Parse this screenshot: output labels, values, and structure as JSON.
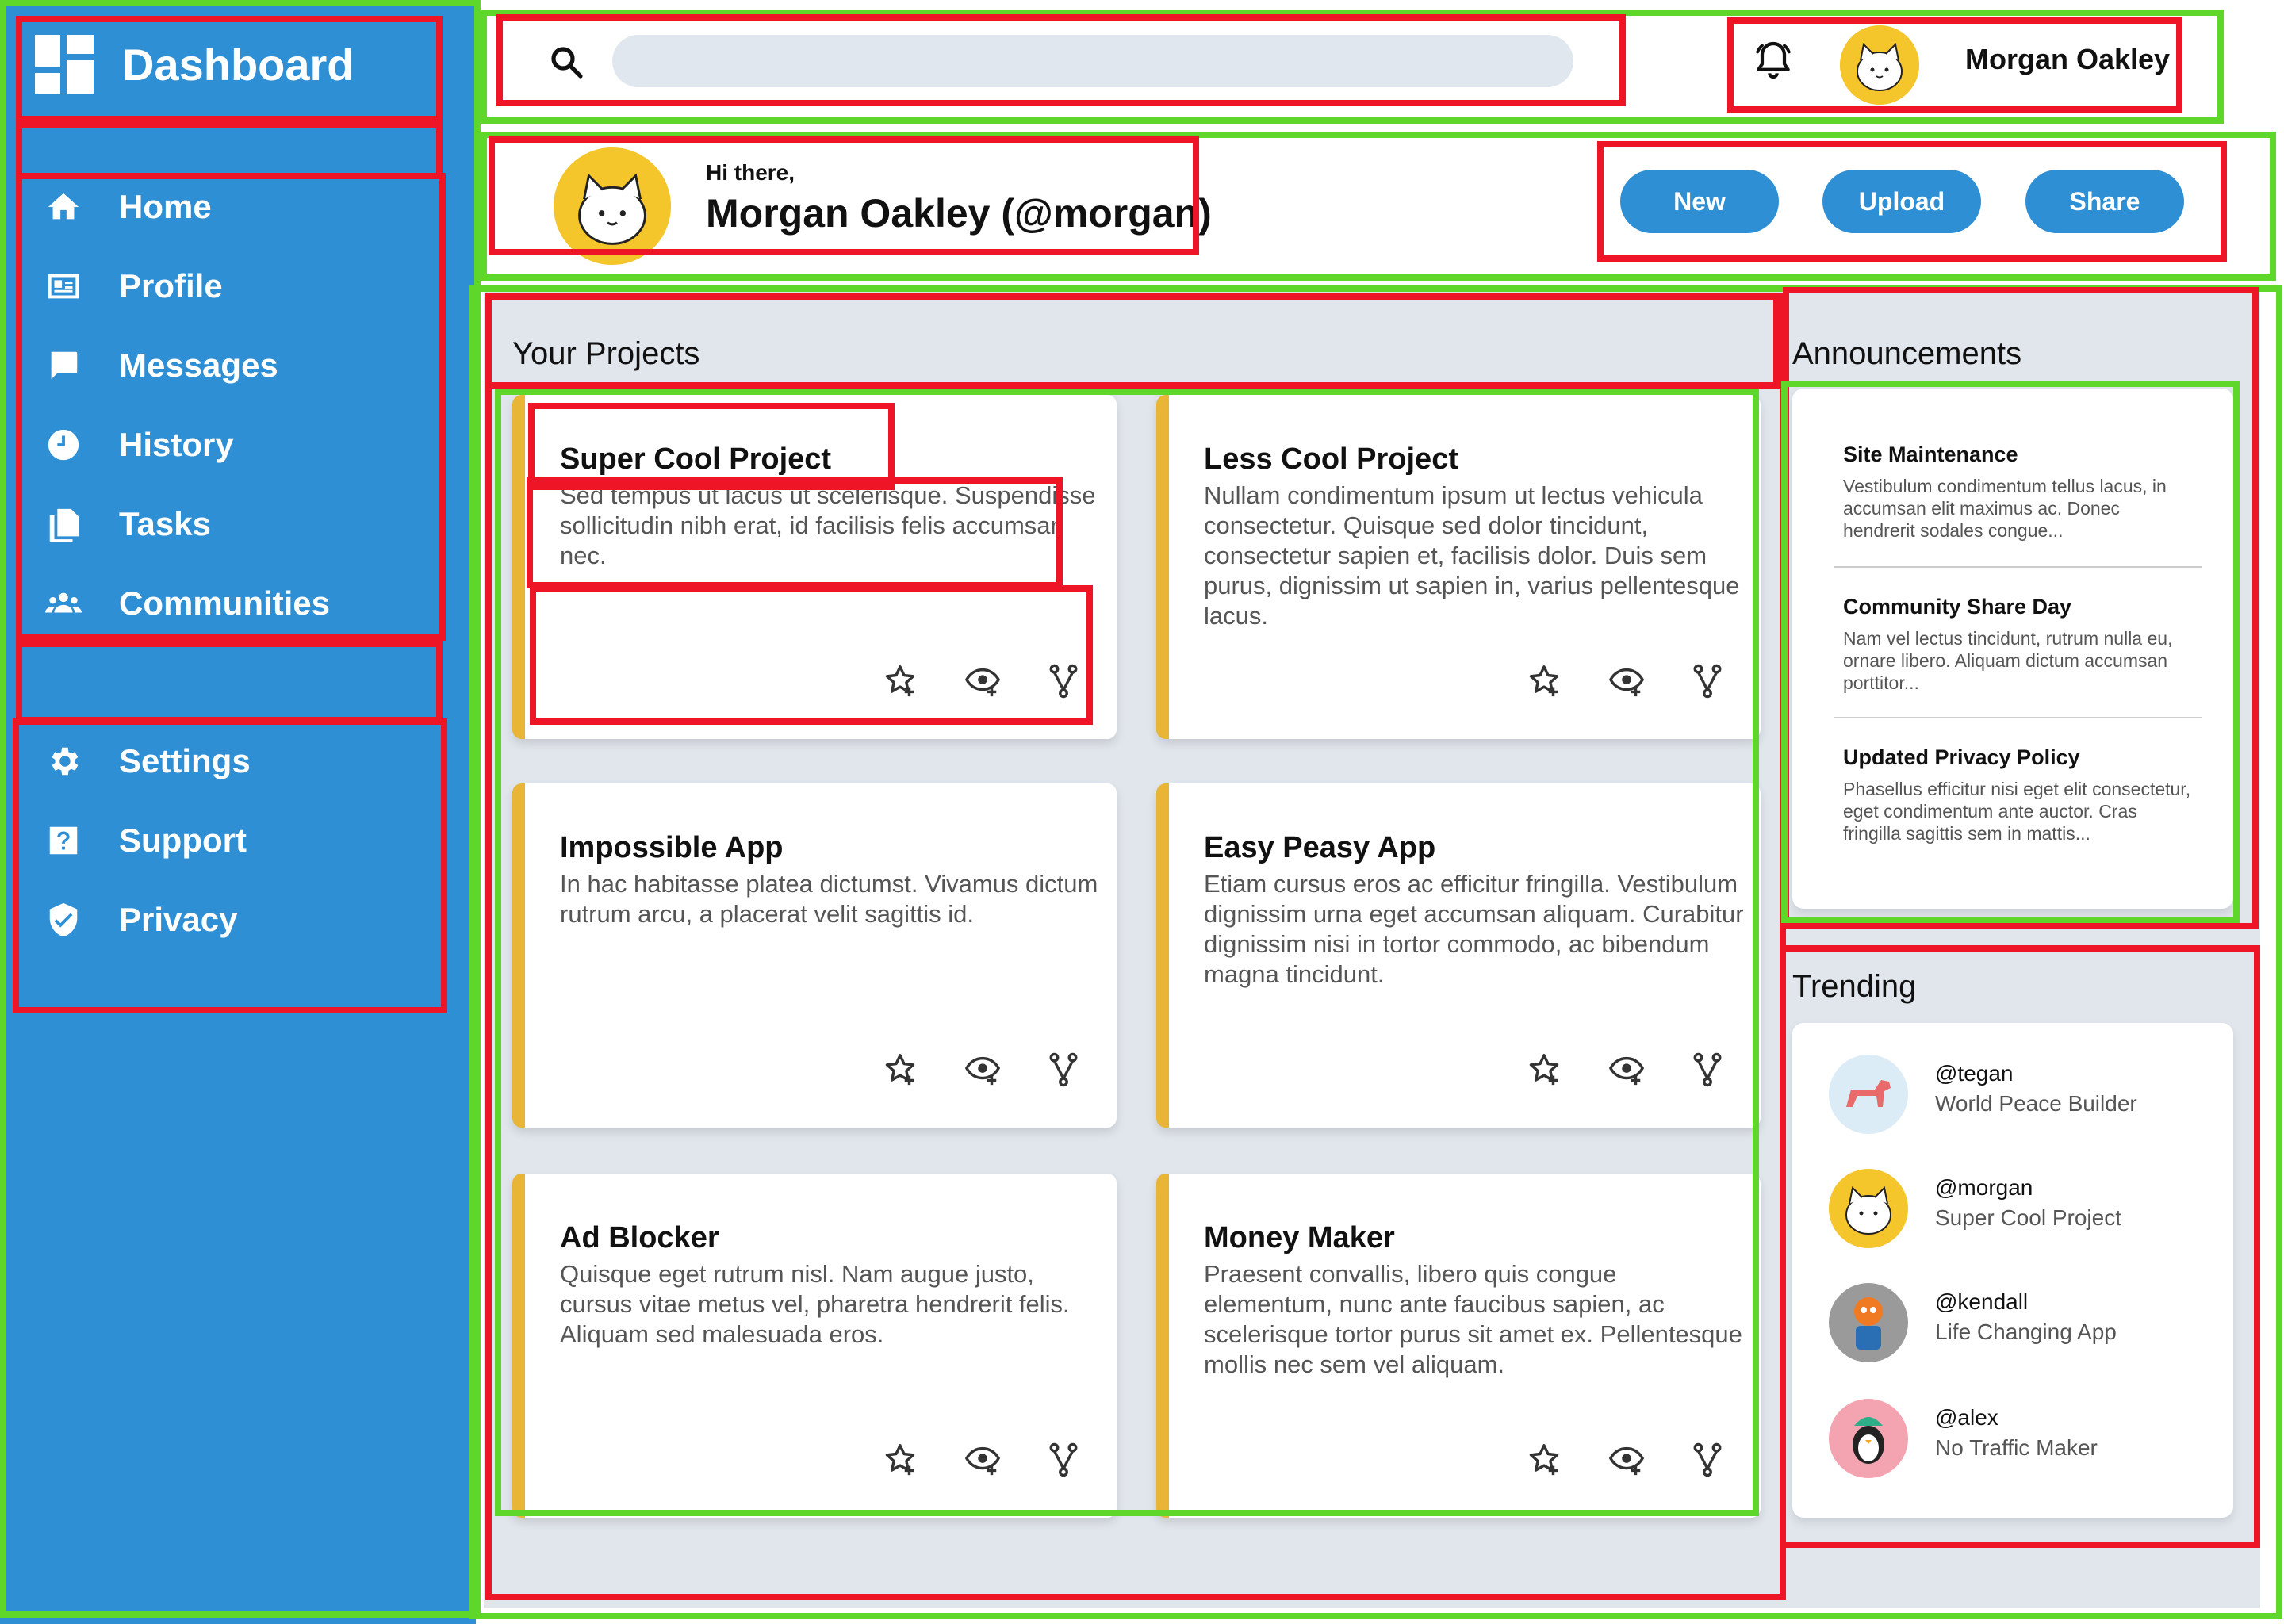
{
  "sidebar": {
    "brand": "Dashboard",
    "nav": [
      {
        "label": "Home",
        "icon": "home-icon"
      },
      {
        "label": "Profile",
        "icon": "profile-icon"
      },
      {
        "label": "Messages",
        "icon": "messages-icon"
      },
      {
        "label": "History",
        "icon": "history-icon"
      },
      {
        "label": "Tasks",
        "icon": "tasks-icon"
      },
      {
        "label": "Communities",
        "icon": "communities-icon"
      }
    ],
    "nav_secondary": [
      {
        "label": "Settings",
        "icon": "gear-icon"
      },
      {
        "label": "Support",
        "icon": "help-icon"
      },
      {
        "label": "Privacy",
        "icon": "shield-icon"
      }
    ]
  },
  "header": {
    "search_placeholder": "",
    "user_name": "Morgan Oakley"
  },
  "greeting": {
    "hi": "Hi there,",
    "name": "Morgan Oakley (@morgan)",
    "buttons": [
      "New",
      "Upload",
      "Share"
    ]
  },
  "projects": {
    "title": "Your Projects",
    "items": [
      {
        "title": "Super Cool Project",
        "desc": "Sed tempus ut lacus ut scelerisque. Suspendisse sollicitudin nibh erat, id facilisis felis accumsan nec."
      },
      {
        "title": "Less Cool Project",
        "desc": "Nullam condimentum ipsum ut lectus vehicula consectetur. Quisque sed dolor tincidunt, consectetur sapien et, facilisis dolor. Duis sem purus, dignissim ut sapien in, varius pellentesque lacus."
      },
      {
        "title": "Impossible App",
        "desc": "In hac habitasse platea dictumst. Vivamus dictum rutrum arcu, a placerat velit sagittis id."
      },
      {
        "title": "Easy Peasy App",
        "desc": "Etiam cursus eros ac efficitur fringilla. Vestibulum dignissim urna eget accumsan aliquam. Curabitur dignissim nisi in tortor commodo, ac bibendum magna tincidunt."
      },
      {
        "title": "Ad Blocker",
        "desc": "Quisque eget rutrum nisl. Nam augue justo, cursus vitae metus vel, pharetra hendrerit felis. Aliquam sed malesuada eros."
      },
      {
        "title": "Money Maker",
        "desc": "Praesent convallis, libero quis congue elementum, nunc ante faucibus sapien, ac scelerisque tortor purus sit amet ex. Pellentesque mollis nec sem vel aliquam."
      }
    ],
    "actions": [
      "star-add-icon",
      "watch-icon",
      "fork-icon"
    ]
  },
  "announcements": {
    "title": "Announcements",
    "items": [
      {
        "title": "Site Maintenance",
        "text": "Vestibulum condimentum tellus lacus, in accumsan elit maximus ac. Donec hendrerit sodales congue..."
      },
      {
        "title": "Community Share Day",
        "text": "Nam vel lectus tincidunt, rutrum nulla eu, ornare libero. Aliquam dictum accumsan porttitor..."
      },
      {
        "title": "Updated Privacy Policy",
        "text": "Phasellus efficitur nisi eget elit consectetur, eget condimentum ante auctor. Cras fringilla sagittis sem in mattis..."
      }
    ]
  },
  "trending": {
    "title": "Trending",
    "items": [
      {
        "handle": "@tegan",
        "desc": "World Peace Builder",
        "avatar_bg": "#dcecf7"
      },
      {
        "handle": "@morgan",
        "desc": "Super Cool Project",
        "avatar_bg": "#f5c52c"
      },
      {
        "handle": "@kendall",
        "desc": "Life Changing App",
        "avatar_bg": "#9a9a9a"
      },
      {
        "handle": "@alex",
        "desc": "No Traffic Maker",
        "avatar_bg": "#f4a3b0"
      }
    ]
  },
  "colors": {
    "sidebar": "#2f8fd5",
    "accent_bar": "#e9b536",
    "content_bg": "#e1e6ed",
    "annotation_green": "#5fd62a",
    "annotation_red": "#ee1626"
  }
}
